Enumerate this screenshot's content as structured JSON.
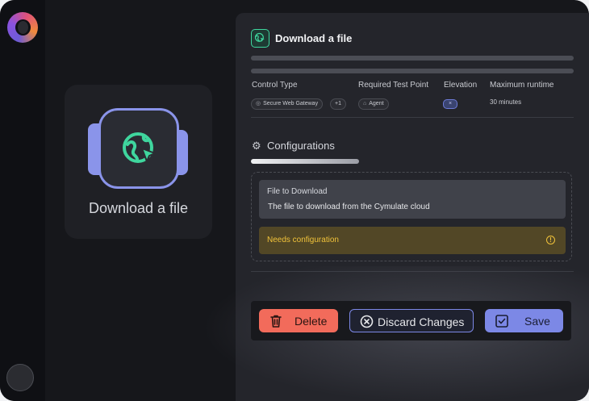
{
  "app": {
    "logo_icon": "cymulate-logo-icon",
    "avatar_icon": "user-avatar"
  },
  "card": {
    "title": "Download a file",
    "icon": "globe-cursor-icon"
  },
  "panel": {
    "title": "Download a file",
    "columns": {
      "control_type": "Control Type",
      "test_point": "Required Test Point",
      "elevation": "Elevation",
      "runtime": "Maximum runtime"
    },
    "control_type_chip": "Secure Web Gateway",
    "control_type_more": "+1",
    "test_point_chip": "Agent",
    "elevation_chip": "×",
    "runtime_value": "30 minutes"
  },
  "configurations": {
    "title": "Configurations",
    "field_label": "File to Download",
    "field_value": "The file to download from the Cymulate cloud",
    "warning": "Needs configuration",
    "warning_icon": "!"
  },
  "actions": {
    "delete": "Delete",
    "discard": "Discard Changes",
    "save": "Save"
  },
  "colors": {
    "accent": "#7c88e6",
    "danger": "#f26b5b",
    "success": "#3fd69e",
    "warning": "#f0c23a"
  }
}
